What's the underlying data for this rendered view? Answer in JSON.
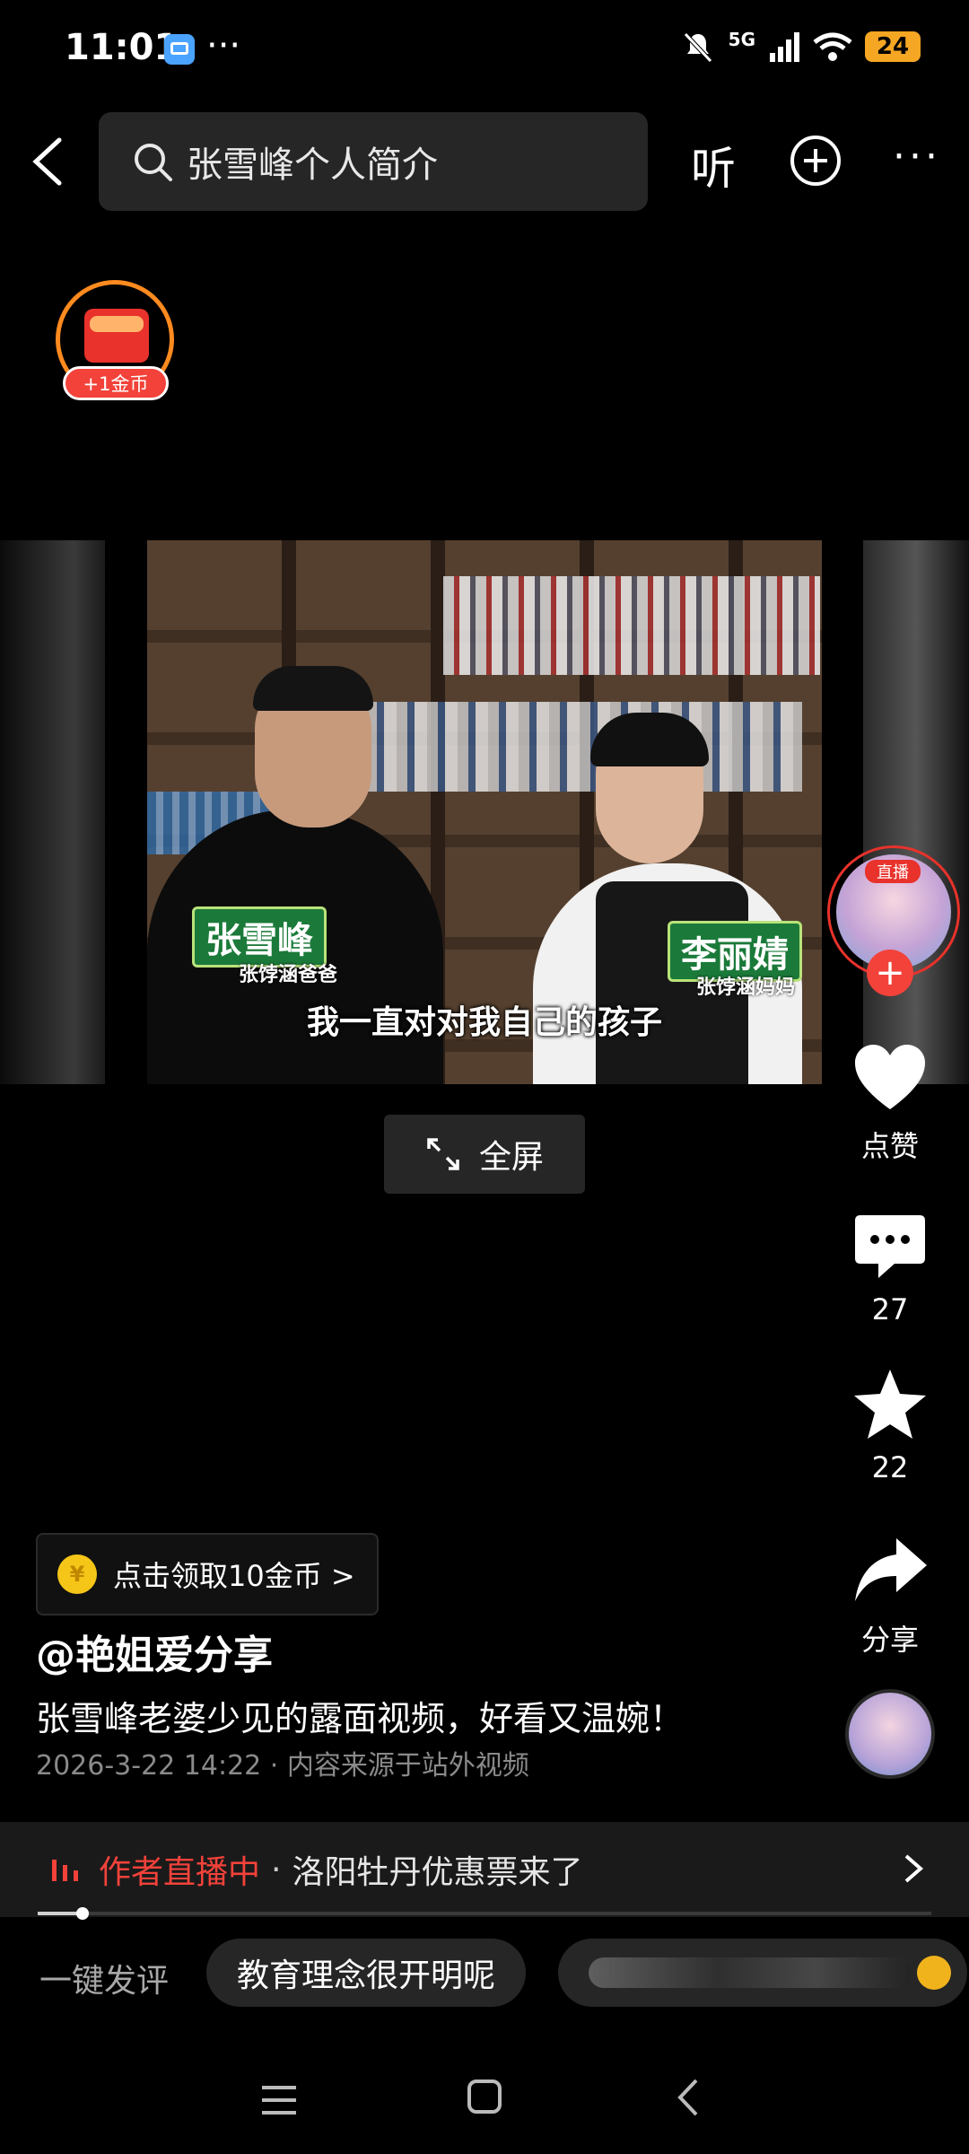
{
  "status_bar": {
    "time": "11:01",
    "dots": "···",
    "network": "5G",
    "battery": "24"
  },
  "search": {
    "query": "张雪峰个人简介"
  },
  "top_actions": {
    "listen_label": "听",
    "more_label": "···"
  },
  "coin_badge": {
    "label": "+1金币"
  },
  "video": {
    "subtitle": "我一直对对我自己的孩子",
    "name_tag_left": "张雪峰",
    "name_sub_left": "张饽涵爸爸",
    "name_tag_right": "李丽婧",
    "name_sub_right": "张饽涵妈妈"
  },
  "fullscreen": {
    "label": "全屏"
  },
  "right_rail": {
    "live_badge": "直播",
    "follow": "+",
    "like_label": "点赞",
    "comment_count": "27",
    "favorite_count": "22",
    "share_label": "分享"
  },
  "post": {
    "claim_coins": "点击领取10金币 >",
    "coin_symbol": "¥",
    "author": "@艳姐爱分享",
    "description": "张雪峰老婆少见的露面视频，好看又温婉！",
    "meta": "2026-3-22 14:22 · 内容来源于站外视频"
  },
  "live_banner": {
    "status": "作者直播中",
    "separator": "·",
    "text": "洛阳牡丹优惠票来了"
  },
  "playback": {
    "progress_fraction": 0.05
  },
  "quick_comment": {
    "label": "一键发评",
    "chips": [
      "教育理念很开明呢"
    ]
  },
  "colors": {
    "accent_red": "#f2423a",
    "coin_orange": "#ff8a1f",
    "background": "#000000"
  }
}
